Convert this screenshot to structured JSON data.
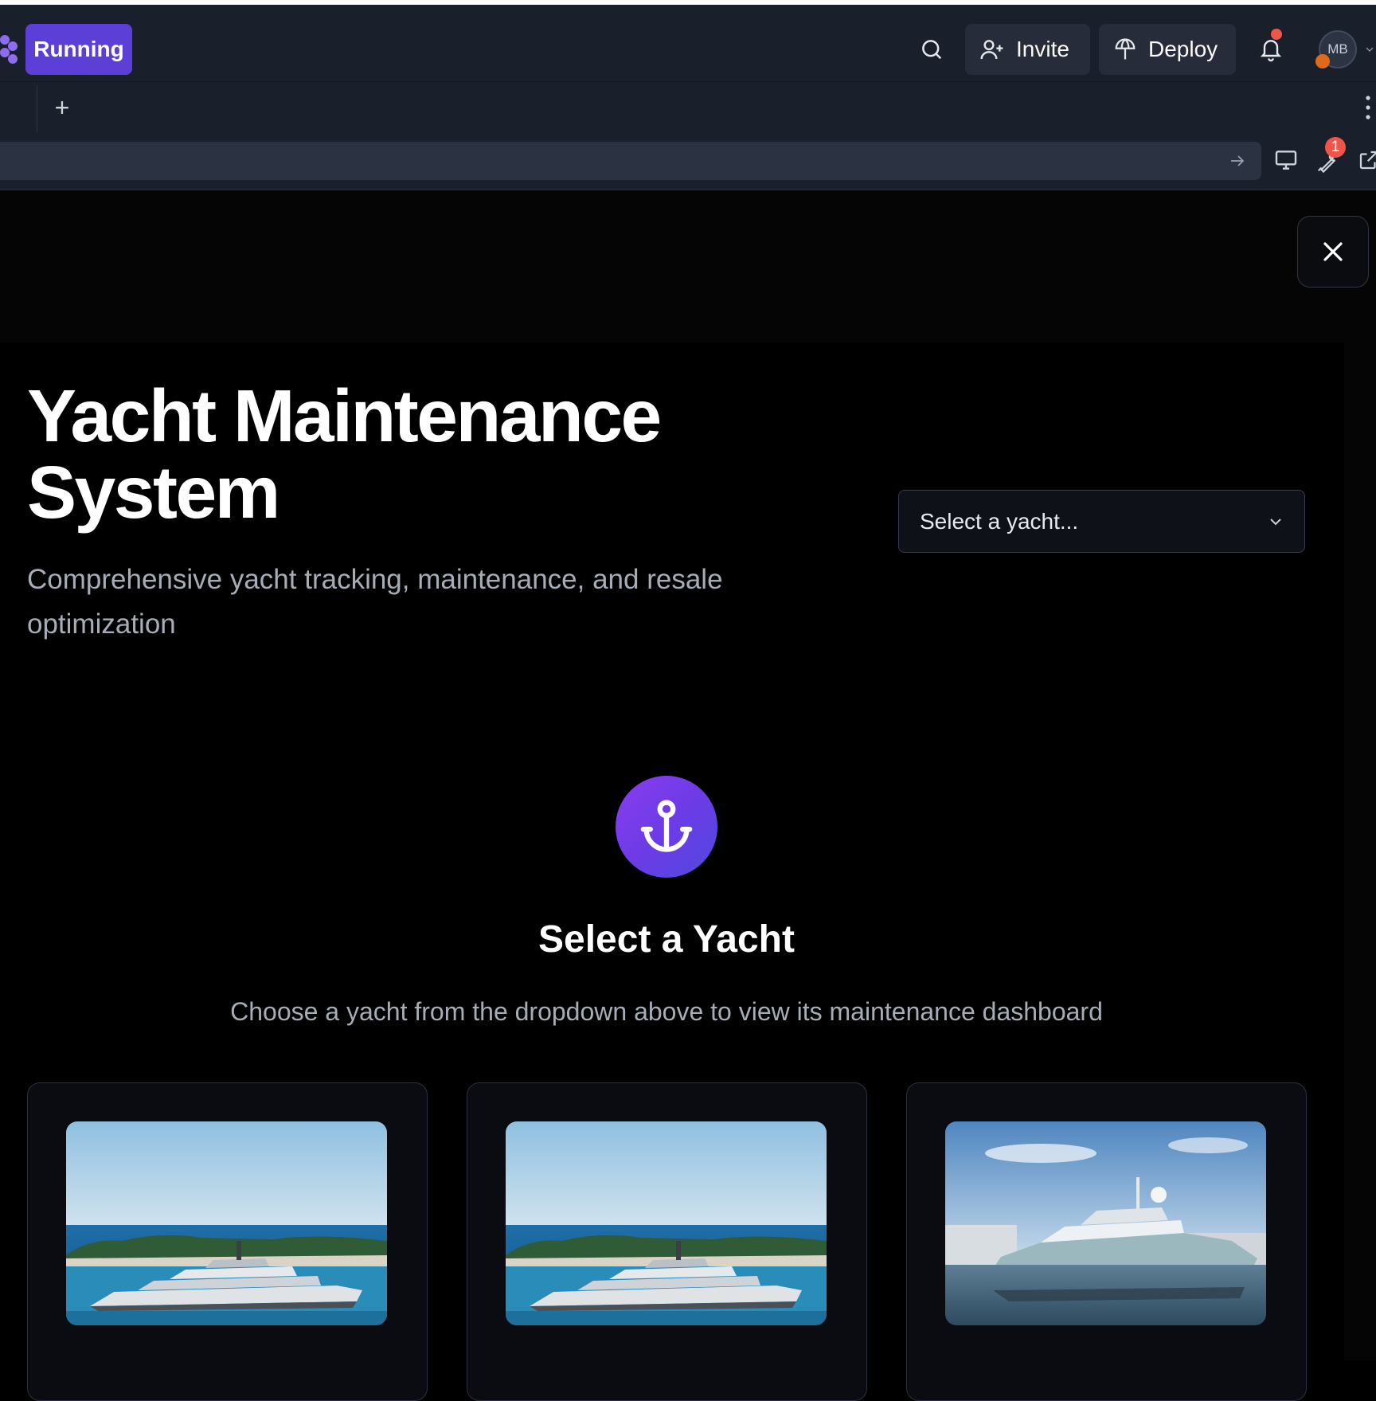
{
  "topbar": {
    "run_label": "Running",
    "invite_label": "Invite",
    "deploy_label": "Deploy",
    "avatar_initials": "MB",
    "icons": [
      "search-icon",
      "add-user-icon",
      "deploy-icon",
      "bell-icon",
      "chevron-down-icon"
    ]
  },
  "tabbar": {
    "new_tab_label": "+"
  },
  "addressbar": {
    "devtools_badge": "1"
  },
  "app": {
    "title": "Yacht Maintenance System",
    "subtitle": "Comprehensive yacht tracking, maintenance, and resale optimization",
    "select": {
      "placeholder": "Select a yacht..."
    },
    "empty_state": {
      "icon": "anchor-icon",
      "title": "Select a Yacht",
      "text": "Choose a yacht from the dropdown above to view its maintenance dashboard"
    },
    "cards": [
      {
        "image": "yacht-at-sea-photo"
      },
      {
        "image": "yacht-at-sea-photo"
      },
      {
        "image": "yacht-in-marina-photo"
      }
    ]
  },
  "colors": {
    "accent": "#5b3fd6",
    "chrome_bg": "#1a1f2c",
    "page_bg": "#000000",
    "muted_text": "#a7adb7",
    "notification": "#f0554a"
  }
}
